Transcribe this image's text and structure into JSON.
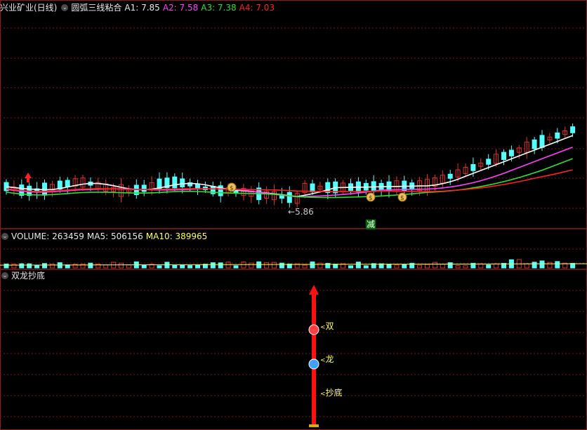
{
  "header": {
    "stock_title": "兴业矿业(日线)",
    "indicator_name": "圆弧三线粘合",
    "a1": "A1: 7.85",
    "a2": "A2: 7.58",
    "a3": "A3: 7.38",
    "a4": "A4: 7.03"
  },
  "volume_header": {
    "volume": "VOLUME: 263459",
    "ma5": "MA5: 506156",
    "ma10": "MA10: 389965"
  },
  "indicator_panel": {
    "title": "双龙抄底",
    "labels": [
      "双",
      "龙",
      "抄底"
    ]
  },
  "annotations": {
    "low_price": "5.86",
    "signal_text": "减",
    "dollar_icons": [
      "dollar-bag-icon",
      "dollar-bag-icon",
      "dollar-bag-icon"
    ]
  },
  "colors": {
    "up": "#e03030",
    "down": "#54ffff",
    "a1": "#ffffff",
    "a2": "#ff40ff",
    "a3": "#30e030",
    "a4": "#ff2020",
    "grid": "#7a1a1a",
    "panel_border": "#8a1c1c",
    "ma10": "#ffff54"
  }
}
